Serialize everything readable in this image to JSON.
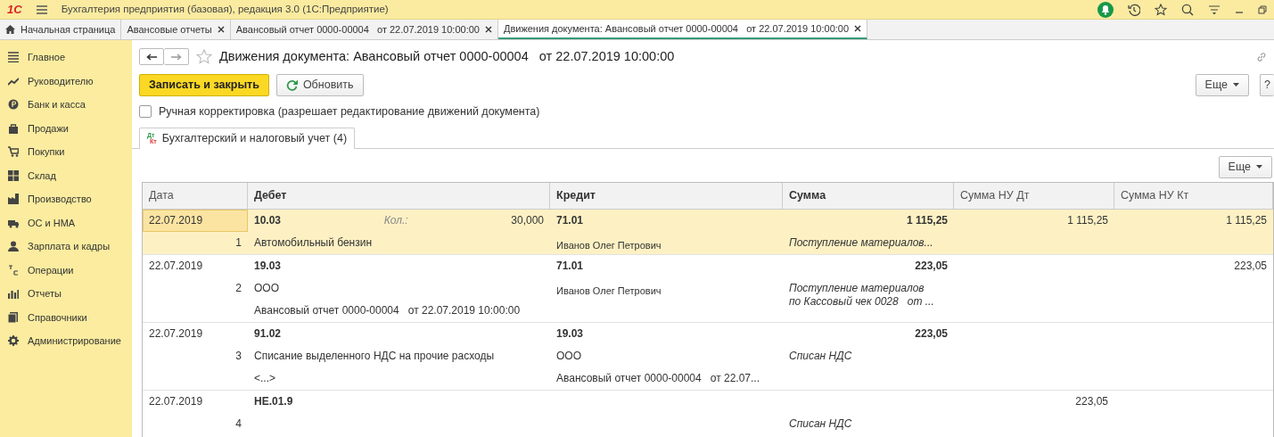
{
  "app": {
    "logo": "1С",
    "title": "Бухгалтерия предприятия (базовая), редакция 3.0  (1С:Предприятие)"
  },
  "tabs": [
    {
      "label": "Начальная страница",
      "kind": "home",
      "selected": false
    },
    {
      "label": "Авансовые отчеты",
      "kind": "closable",
      "selected": false
    },
    {
      "label": "Авансовый отчет 0000-00004   от 22.07.2019 10:00:00",
      "kind": "closable",
      "selected": false
    },
    {
      "label": "Движения документа: Авансовый отчет 0000-00004   от 22.07.2019 10:00:00",
      "kind": "closable",
      "selected": true
    }
  ],
  "sidebar": {
    "items": [
      {
        "label": "Главное"
      },
      {
        "label": "Руководителю"
      },
      {
        "label": "Банк и касса"
      },
      {
        "label": "Продажи"
      },
      {
        "label": "Покупки"
      },
      {
        "label": "Склад"
      },
      {
        "label": "Производство"
      },
      {
        "label": "ОС и НМА"
      },
      {
        "label": "Зарплата и кадры"
      },
      {
        "label": "Операции"
      },
      {
        "label": "Отчеты"
      },
      {
        "label": "Справочники"
      },
      {
        "label": "Администрирование"
      }
    ]
  },
  "form": {
    "title": "Движения документа: Авансовый отчет 0000-00004   от 22.07.2019 10:00:00",
    "buttons": [
      {
        "label": "Записать и закрыть",
        "kind": "primary"
      },
      {
        "label": "Обновить",
        "kind": "refresh"
      }
    ],
    "more_button": "Еще",
    "help_button": "?",
    "manual_edit": {
      "label": "Ручная корректировка (разрешает редактирование движений документа)",
      "checked": false
    },
    "section_tab": {
      "icon_top": "Дт",
      "icon_bottom": "Кт",
      "label": "Бухгалтерский и налоговый учет (4)",
      "selected": true
    },
    "table_more_button": "Еще"
  },
  "table": {
    "columns": [
      "Дата",
      "Дебет",
      "Кредит",
      "Сумма",
      "Сумма НУ Дт",
      "Сумма НУ Кт"
    ],
    "rows": [
      {
        "date": "22.07.2019",
        "number": "1",
        "selected": true,
        "debit_account": "10.03",
        "quantity_label": "Кол.:",
        "quantity": "30,000",
        "debit_lines": [
          "Автомобильный бензин"
        ],
        "credit_account": "71.01",
        "credit_lines": [
          "Иванов Олег Петрович"
        ],
        "sum": "1 115,25",
        "sum_note": "Поступление материалов...",
        "nu_dt": "1 115,25",
        "nu_kt": "1 115,25"
      },
      {
        "date": "22.07.2019",
        "number": "2",
        "selected": false,
        "debit_account": "19.03",
        "debit_lines": [
          "ООО",
          "Авансовый отчет 0000-00004   от 22.07.2019 10:00:00"
        ],
        "credit_account": "71.01",
        "credit_lines": [
          "Иванов Олег Петрович"
        ],
        "sum": "223,05",
        "sum_note": "Поступление материалов\nпо Кассовый чек 0028   от ...",
        "nu_kt": "223,05"
      },
      {
        "date": "22.07.2019",
        "number": "3",
        "selected": false,
        "debit_account": "91.02",
        "debit_lines": [
          "Списание выделенного НДС на прочие расходы",
          "<...>"
        ],
        "credit_account": "19.03",
        "credit_lines": [
          "ООО",
          "Авансовый отчет 0000-00004   от 22.07..."
        ],
        "sum": "223,05",
        "sum_note": "Списан НДС"
      },
      {
        "date": "22.07.2019",
        "number": "4",
        "selected": false,
        "debit_account": "НЕ.01.9",
        "nu_dt": "223,05",
        "sum_note": "Списан НДС"
      }
    ]
  }
}
